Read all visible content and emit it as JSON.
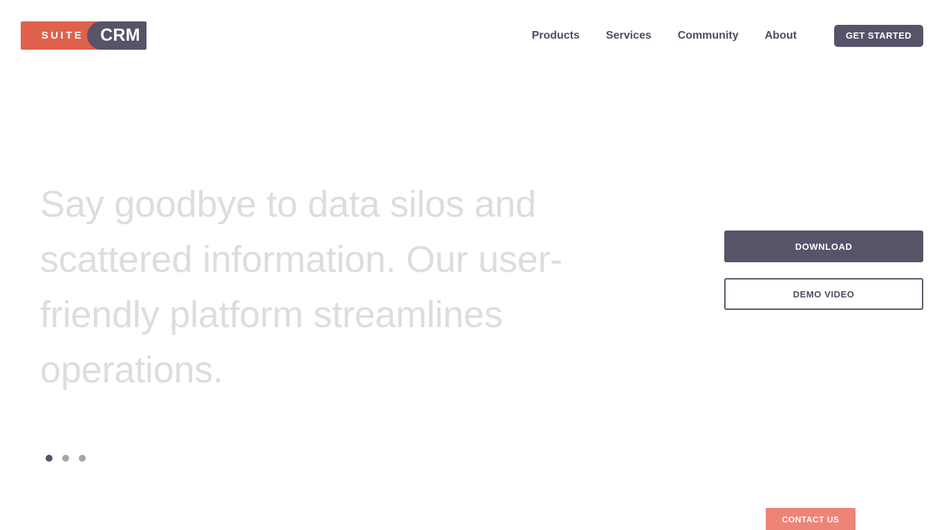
{
  "site": {
    "title": "SuiteCRM"
  },
  "header": {
    "logo": {
      "suite_text": "SUITE",
      "crm_text": "CRM",
      "suite_bg": "#e0614c",
      "crm_bg": "#595369"
    },
    "nav": [
      {
        "label": "Products"
      },
      {
        "label": "Services"
      },
      {
        "label": "Community"
      },
      {
        "label": "About"
      }
    ],
    "cta": {
      "label": "GET STARTED",
      "bg": "#595369",
      "color": "#ffffff"
    }
  },
  "hero": {
    "heading": "Say goodbye to data silos and scattered information. Our user-friendly platform streamlines operations.",
    "heading_color": "#dcdddf",
    "carousel": {
      "active_index": 0,
      "dots": [
        {
          "label": "Slide 1",
          "active": true
        },
        {
          "label": "Slide 2",
          "active": false
        },
        {
          "label": "Slide 3",
          "active": false
        }
      ],
      "active_color": "#565068",
      "inactive_color": "#a8a4b4"
    },
    "actions": {
      "download_label": "DOWNLOAD",
      "demo_label": "DEMO VIDEO",
      "download_bg": "#595369",
      "demo_border": "#595369"
    }
  },
  "floating": {
    "contact_label": "CONTACT US",
    "contact_bg": "#ed8477"
  }
}
